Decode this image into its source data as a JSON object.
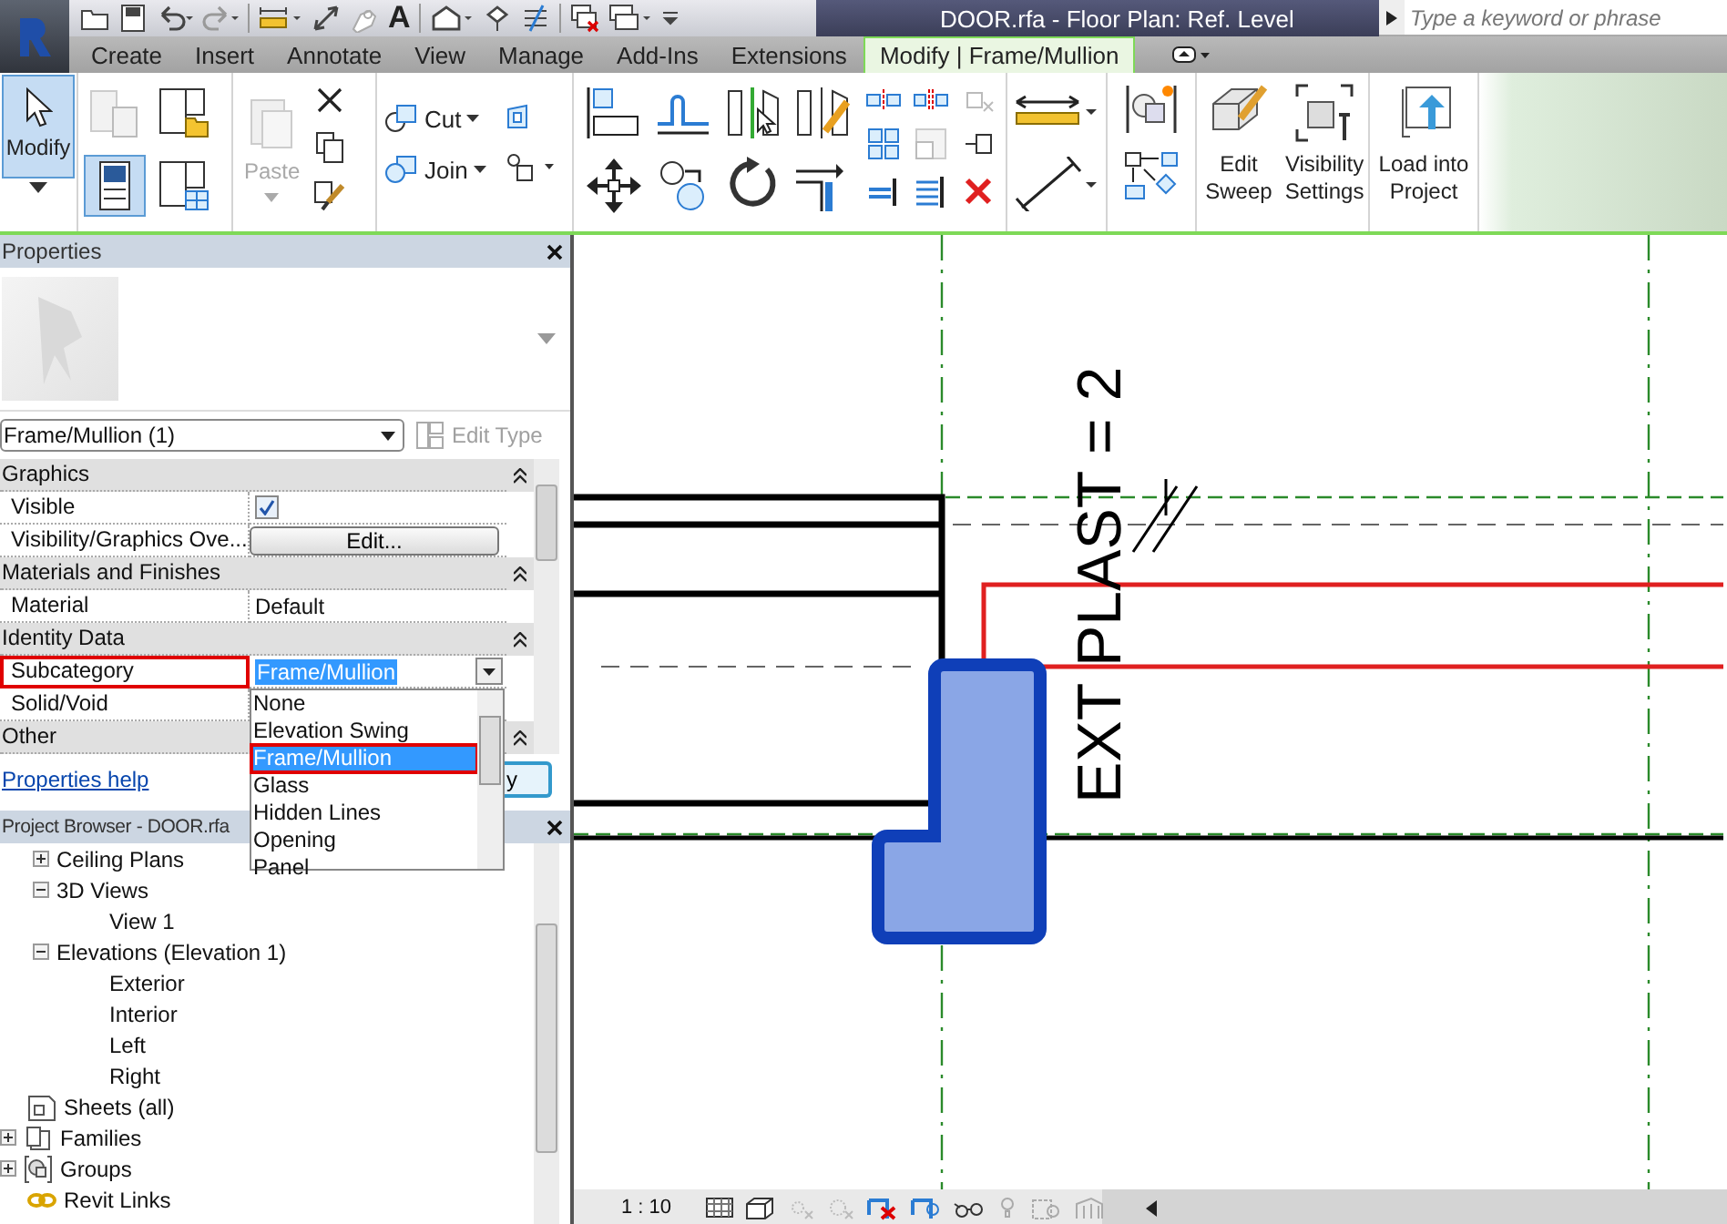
{
  "app": {
    "title": "DOOR.rfa - Floor Plan: Ref. Level",
    "text_tool": "A",
    "search": {
      "placeholder": "Type a keyword or phrase"
    }
  },
  "tabs": [
    {
      "label": "Create",
      "selected": false
    },
    {
      "label": "Insert",
      "selected": false
    },
    {
      "label": "Annotate",
      "selected": false
    },
    {
      "label": "View",
      "selected": false
    },
    {
      "label": "Manage",
      "selected": false
    },
    {
      "label": "Add-Ins",
      "selected": false
    },
    {
      "label": "Extensions",
      "selected": false
    },
    {
      "label": "Modify | Frame/Mullion",
      "selected": true
    }
  ],
  "ribbon": {
    "modify": {
      "label": "Modify",
      "selected": true
    },
    "paste": {
      "label": "Paste",
      "disabled": true
    },
    "cut": {
      "label": "Cut"
    },
    "join": {
      "label": "Join"
    },
    "big_buttons": [
      {
        "kind": "sweep",
        "label": "Edit Sweep"
      },
      {
        "kind": "visibility",
        "label": "Visibility Settings"
      },
      {
        "kind": "load",
        "label": "Load into Project"
      }
    ]
  },
  "properties": {
    "title": "Properties",
    "type_selector": "Frame/Mullion (1)",
    "edit_type": {
      "label": "Edit Type",
      "disabled": true
    },
    "rows": [
      {
        "kind": "group",
        "label": "Graphics",
        "outlined": false
      },
      {
        "kind": "checkbox",
        "label": "Visible",
        "checked": true,
        "outlined": false
      },
      {
        "kind": "button",
        "label": "Visibility/Graphics Ove...",
        "value": "Edit...",
        "outlined": false
      },
      {
        "kind": "group",
        "label": "Materials and Finishes",
        "outlined": false
      },
      {
        "kind": "text",
        "label": "Material",
        "value": "Default",
        "outlined": false
      },
      {
        "kind": "group",
        "label": "Identity Data",
        "outlined": false
      },
      {
        "kind": "dropdown",
        "label": "Subcategory",
        "value": "Frame/Mullion",
        "outlined": true
      },
      {
        "kind": "text",
        "label": "Solid/Void",
        "outlined": false
      },
      {
        "kind": "group",
        "label": "Other",
        "outlined": false
      }
    ],
    "dropdown": {
      "options": [
        {
          "label": "None",
          "selected": false,
          "outlined": false
        },
        {
          "label": "Elevation Swing",
          "selected": false,
          "outlined": false
        },
        {
          "label": "Frame/Mullion",
          "selected": true,
          "outlined": true
        },
        {
          "label": "Glass",
          "selected": false,
          "outlined": false
        },
        {
          "label": "Hidden Lines",
          "selected": false,
          "outlined": false
        },
        {
          "label": "Opening",
          "selected": false,
          "outlined": false
        },
        {
          "label": "Panel",
          "selected": false,
          "outlined": false
        }
      ]
    },
    "help_link": "Properties help",
    "apply_button": "y"
  },
  "project_browser": {
    "title": "Project Browser - DOOR.rfa",
    "view_types": [
      {
        "label": "Ceiling Plans",
        "expanded": false
      },
      {
        "label": "3D Views",
        "expanded": true,
        "children": [
          {
            "label": "View 1"
          }
        ]
      },
      {
        "label": "Elevations (Elevation 1)",
        "expanded": true,
        "children": [
          {
            "label": "Exterior"
          },
          {
            "label": "Interior"
          },
          {
            "label": "Left"
          },
          {
            "label": "Right"
          }
        ]
      }
    ],
    "categories": [
      {
        "kind": "sheets",
        "label": "Sheets (all)"
      },
      {
        "kind": "families",
        "label": "Families",
        "expanded": false
      },
      {
        "kind": "groups",
        "label": "Groups",
        "expanded": false
      },
      {
        "kind": "links",
        "label": "Revit Links"
      }
    ]
  },
  "canvas": {
    "annotation": "EXT PLAST = 2"
  },
  "view_control": {
    "scale": "1 : 10"
  }
}
